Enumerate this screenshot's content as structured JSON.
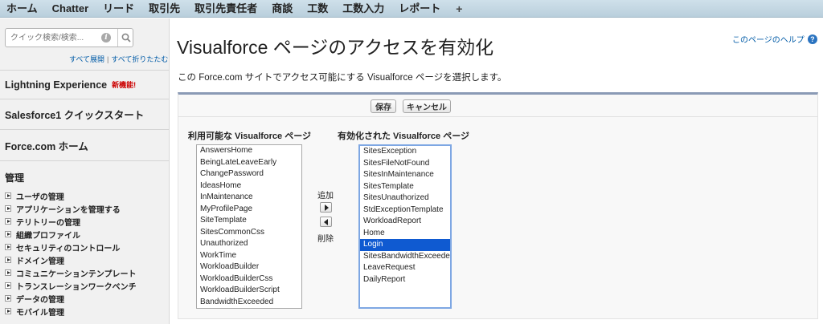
{
  "topnav": {
    "tabs": [
      "ホーム",
      "Chatter",
      "リード",
      "取引先",
      "取引先責任者",
      "商談",
      "工数",
      "工数入力",
      "レポート"
    ],
    "plus_label": "+"
  },
  "sidebar": {
    "search": {
      "placeholder": "クイック検索/検索...",
      "value": ""
    },
    "expand_all": "すべて展開",
    "separator": "|",
    "collapse_all": "すべて折りたたむ",
    "sections": [
      {
        "label": "Lightning Experience",
        "badge": "新機能!"
      },
      {
        "label": "Salesforce1 クイックスタート"
      },
      {
        "label": "Force.com ホーム"
      }
    ],
    "admin_heading": "管理",
    "tree_items": [
      "ユーザの管理",
      "アプリケーションを管理する",
      "テリトリーの管理",
      "組織プロファイル",
      "セキュリティのコントロール",
      "ドメイン管理",
      "コミュニケーションテンプレート",
      "トランスレーションワークベンチ",
      "データの管理",
      "モバイル管理"
    ]
  },
  "main": {
    "title": "Visualforce ページのアクセスを有効化",
    "help_link": "このページのヘルプ",
    "description": "この Force.com サイトでアクセス可能にする Visualforce ページを選択します。",
    "save_label": "保存",
    "cancel_label": "キャンセル",
    "available_label": "利用可能な Visualforce ページ",
    "enabled_label": "有効化された Visualforce ページ",
    "add_label": "追加",
    "remove_label": "削除",
    "available_pages": [
      "AnswersHome",
      "BeingLateLeaveEarly",
      "ChangePassword",
      "IdeasHome",
      "InMaintenance",
      "MyProfilePage",
      "SiteTemplate",
      "SitesCommonCss",
      "Unauthorized",
      "WorkTime",
      "WorkloadBuilder",
      "WorkloadBuilderCss",
      "WorkloadBuilderScript",
      "BandwidthExceeded"
    ],
    "enabled_pages": [
      "SitesException",
      "SitesFileNotFound",
      "SitesInMaintenance",
      "SitesTemplate",
      "SitesUnauthorized",
      "StdExceptionTemplate",
      "WorkloadReport",
      "Home",
      "Login",
      "SitesBandwidthExceeded",
      "LeaveRequest",
      "DailyReport"
    ],
    "selected_enabled_page": "Login"
  },
  "colors": {
    "link": "#015ba7",
    "selection": "#0f5ad1",
    "new_badge": "#cc0000"
  }
}
